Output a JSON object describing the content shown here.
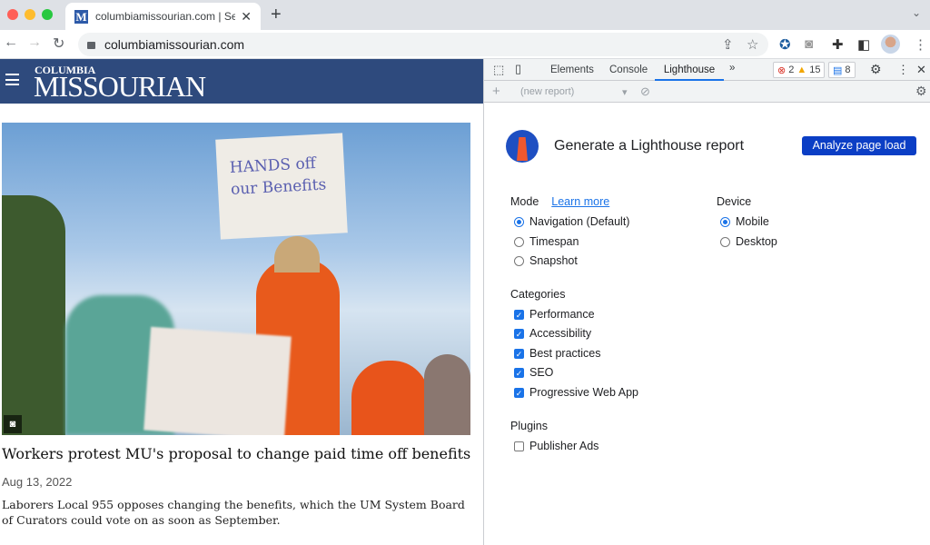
{
  "browser": {
    "tab_title": "columbiamissourian.com | Serv",
    "favicon": "M",
    "url": "columbiamissourian.com",
    "colors": {
      "close": "#ff5f57",
      "minimize": "#febc2e",
      "maximize": "#28c840"
    }
  },
  "site": {
    "logo_top": "COLUMBIA",
    "logo_main": "MISSOURIAN",
    "sign_text": "HANDS off our Benefits",
    "headline": "Workers protest MU's proposal to change paid time off benefits",
    "date": "Aug 13, 2022",
    "summary": "Laborers Local 955 opposes changing the benefits, which the UM System Board of Curators could vote on as soon as September.",
    "brand_color": "#2e4a7d"
  },
  "devtools": {
    "tabs": [
      "Elements",
      "Console",
      "Lighthouse"
    ],
    "more": "»",
    "errors": "2",
    "warnings": "15",
    "messages": "8",
    "report_select": "(new report)"
  },
  "lighthouse": {
    "title": "Generate a Lighthouse report",
    "analyze_button": "Analyze page load",
    "mode_label": "Mode",
    "learn_more": "Learn more",
    "modes": [
      {
        "label": "Navigation (Default)",
        "selected": true
      },
      {
        "label": "Timespan",
        "selected": false
      },
      {
        "label": "Snapshot",
        "selected": false
      }
    ],
    "device_label": "Device",
    "devices": [
      {
        "label": "Mobile",
        "selected": true
      },
      {
        "label": "Desktop",
        "selected": false
      }
    ],
    "categories_label": "Categories",
    "categories": [
      {
        "label": "Performance",
        "checked": true
      },
      {
        "label": "Accessibility",
        "checked": true
      },
      {
        "label": "Best practices",
        "checked": true
      },
      {
        "label": "SEO",
        "checked": true
      },
      {
        "label": "Progressive Web App",
        "checked": true
      }
    ],
    "plugins_label": "Plugins",
    "plugins": [
      {
        "label": "Publisher Ads",
        "checked": false
      }
    ],
    "accent": "#0b3ec5"
  }
}
